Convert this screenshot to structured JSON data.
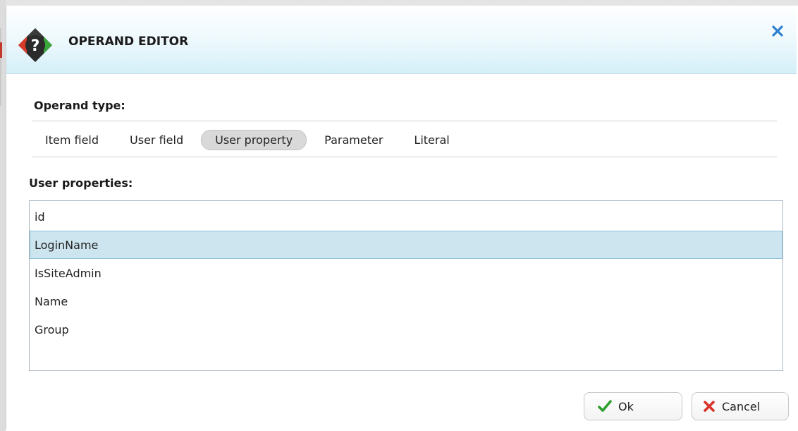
{
  "dialog": {
    "title": "OPERAND EDITOR"
  },
  "operand_type": {
    "label": "Operand type:",
    "tabs": [
      {
        "label": "Item field",
        "active": false
      },
      {
        "label": "User field",
        "active": false
      },
      {
        "label": "User property",
        "active": true
      },
      {
        "label": "Parameter",
        "active": false
      },
      {
        "label": "Literal",
        "active": false
      }
    ]
  },
  "user_properties": {
    "label": "User properties:",
    "items": [
      {
        "label": "id",
        "selected": false
      },
      {
        "label": "LoginName",
        "selected": true
      },
      {
        "label": "IsSiteAdmin",
        "selected": false
      },
      {
        "label": "Name",
        "selected": false
      },
      {
        "label": "Group",
        "selected": false
      }
    ]
  },
  "buttons": {
    "ok_label": "Ok",
    "cancel_label": "Cancel"
  },
  "icons": {
    "logo": "help-diamond-icon",
    "close": "close-icon",
    "ok": "checkmark-icon",
    "cancel": "cross-icon"
  },
  "colors": {
    "selected_row": "#cde5ef",
    "close_blue": "#2f7fd0",
    "ok_green": "#2e9e2e",
    "cancel_red": "#d8322a"
  }
}
